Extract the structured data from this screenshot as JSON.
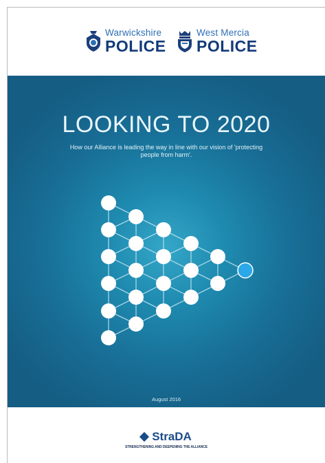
{
  "header": {
    "left_logo": {
      "force": "Warwickshire",
      "police": "POLICE",
      "crest_icon": "warwickshire-crest-icon"
    },
    "right_logo": {
      "force": "West Mercia",
      "police": "POLICE",
      "crest_icon": "west-mercia-crest-icon"
    }
  },
  "cover": {
    "title": "LOOKING TO 2020",
    "subtitle": "How our Alliance is leading the way in line with our vision of 'protecting people from harm'.",
    "date": "August 2016",
    "colors": {
      "panel": "#186f97",
      "node": "#ffffff",
      "accent_node": "#2aa8e8"
    }
  },
  "footer": {
    "brand": "StraDA",
    "tagline": "STRENGTHENING AND DEEPENING THE ALLIANCE",
    "brand_icon": "diamond-icon"
  }
}
